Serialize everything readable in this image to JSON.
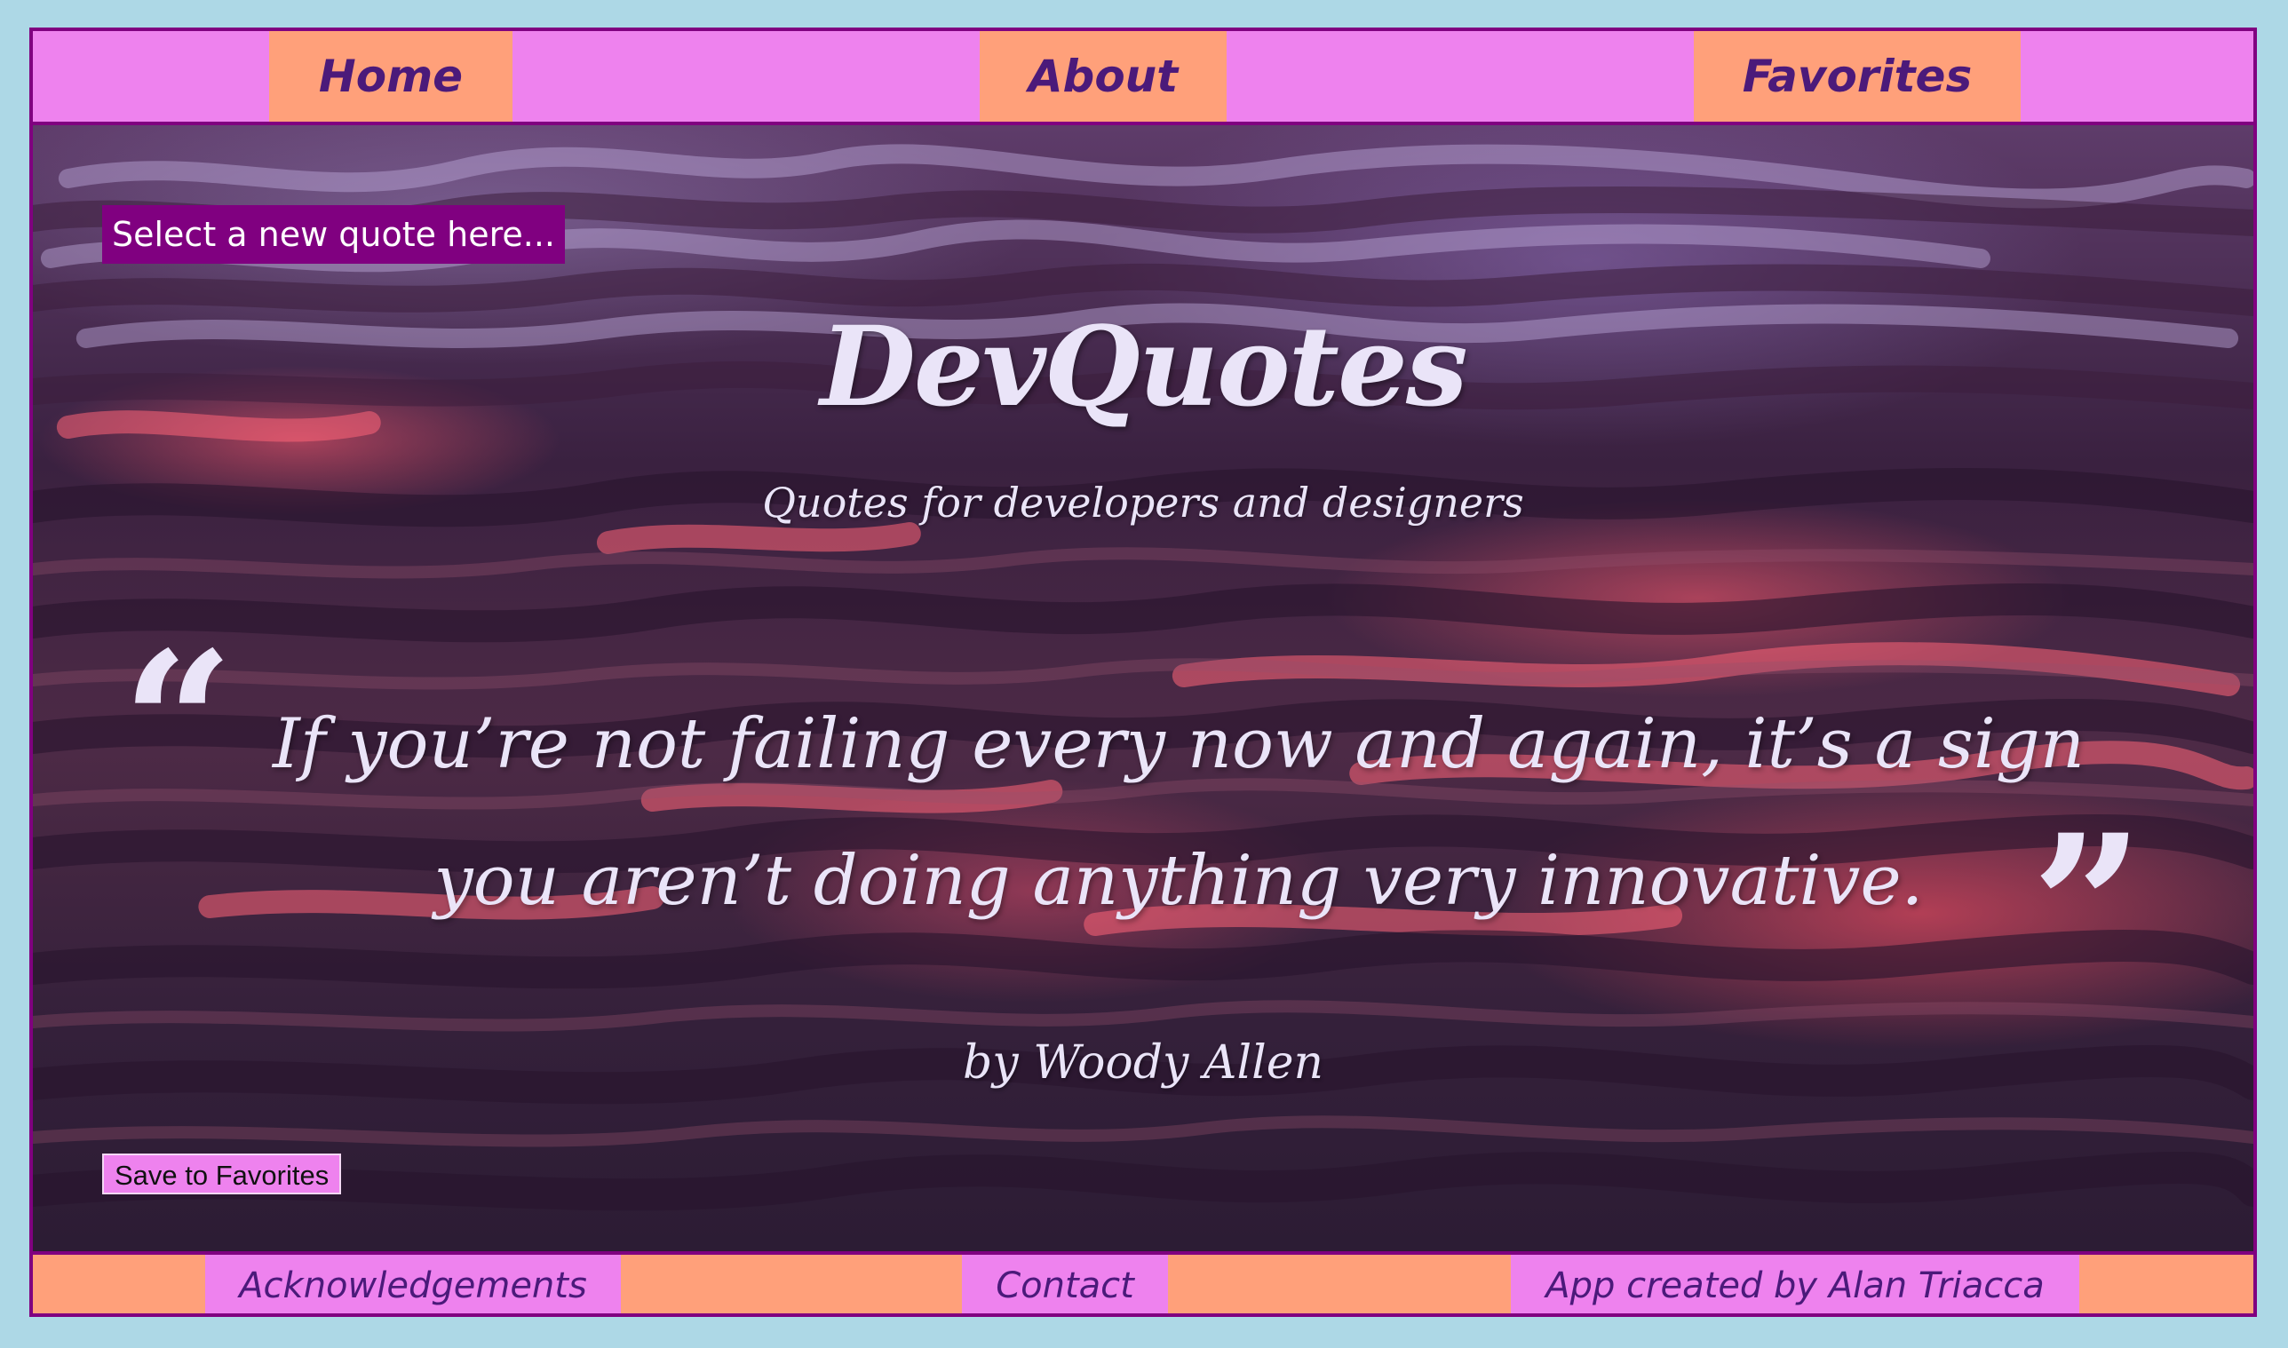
{
  "nav": {
    "home": "Home",
    "about": "About",
    "favorites": "Favorites"
  },
  "select_quote_label": "Select a new quote here...",
  "header": {
    "title": "DevQuotes",
    "subtitle": "Quotes for developers and designers"
  },
  "quote": {
    "open_mark": "“",
    "close_mark": "”",
    "line1": "If you’re not failing every now and again, it’s a sign",
    "line2": "you aren’t doing anything very innovative.",
    "author": "by Woody Allen"
  },
  "save_button_label": "Save to Favorites",
  "footer": {
    "acknowledgements": "Acknowledgements",
    "contact": "Contact",
    "credit": "App created by Alan Triacca"
  },
  "colors": {
    "page_background": "#add8e6",
    "nav_bar": "#ee82ee",
    "nav_tab": "#ffa07a",
    "border": "#800080",
    "text_purple": "#4b1a7a",
    "quote_text": "#eae4f8"
  }
}
